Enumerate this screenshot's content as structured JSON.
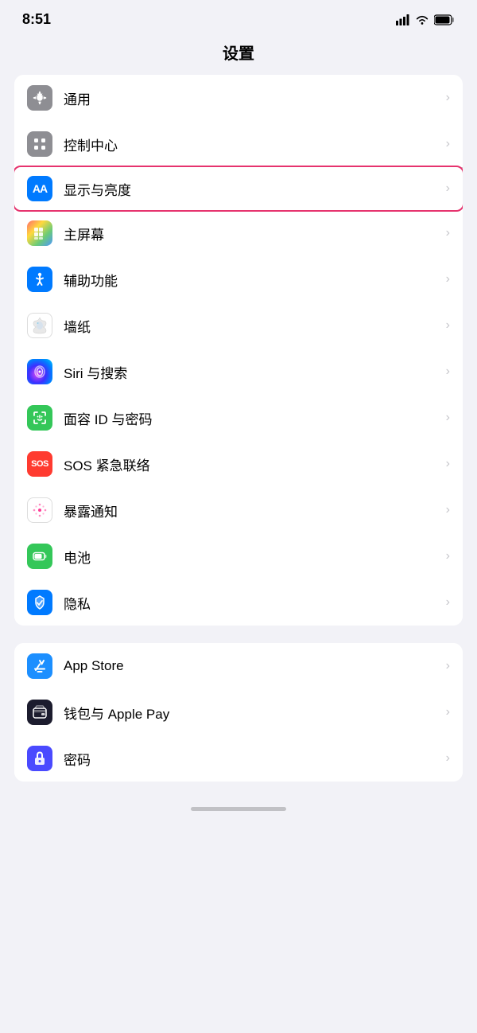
{
  "statusBar": {
    "time": "8:51",
    "signal": "signal",
    "wifi": "wifi",
    "battery": "battery"
  },
  "pageTitle": "设置",
  "group1": {
    "items": [
      {
        "id": "general",
        "label": "通用",
        "iconBg": "icon-gray",
        "iconType": "gear",
        "highlighted": false
      },
      {
        "id": "controlcenter",
        "label": "控制中心",
        "iconBg": "icon-gray2",
        "iconType": "toggle",
        "highlighted": false
      },
      {
        "id": "display",
        "label": "显示与亮度",
        "iconBg": "icon-blue",
        "iconType": "aa",
        "highlighted": true
      },
      {
        "id": "homescreen",
        "label": "主屏幕",
        "iconBg": "icon-colorful",
        "iconType": "grid",
        "highlighted": false
      },
      {
        "id": "accessibility",
        "label": "辅助功能",
        "iconBg": "icon-blue2",
        "iconType": "accessibility",
        "highlighted": false
      },
      {
        "id": "wallpaper",
        "label": "墙纸",
        "iconBg": "icon-flower",
        "iconType": "flower",
        "highlighted": false
      },
      {
        "id": "siri",
        "label": "Siri 与搜索",
        "iconBg": "icon-siri",
        "iconType": "siri",
        "highlighted": false
      },
      {
        "id": "faceid",
        "label": "面容 ID 与密码",
        "iconBg": "icon-green2",
        "iconType": "faceid",
        "highlighted": false
      },
      {
        "id": "sos",
        "label": "SOS 紧急联络",
        "iconBg": "icon-red",
        "iconType": "sos",
        "highlighted": false
      },
      {
        "id": "exposure",
        "label": "暴露通知",
        "iconBg": "icon-pink-dots",
        "iconType": "exposure",
        "highlighted": false
      },
      {
        "id": "battery",
        "label": "电池",
        "iconBg": "icon-green3",
        "iconType": "battery",
        "highlighted": false
      },
      {
        "id": "privacy",
        "label": "隐私",
        "iconBg": "icon-blue3",
        "iconType": "hand",
        "highlighted": false
      }
    ]
  },
  "group2": {
    "items": [
      {
        "id": "appstore",
        "label": "App Store",
        "iconBg": "icon-appstore",
        "iconType": "appstore",
        "highlighted": false
      },
      {
        "id": "wallet",
        "label": "钱包与 Apple Pay",
        "iconBg": "icon-wallet",
        "iconType": "wallet",
        "highlighted": false
      },
      {
        "id": "password",
        "label": "密码",
        "iconBg": "icon-password",
        "iconType": "password",
        "highlighted": false
      }
    ]
  },
  "chevron": "›"
}
